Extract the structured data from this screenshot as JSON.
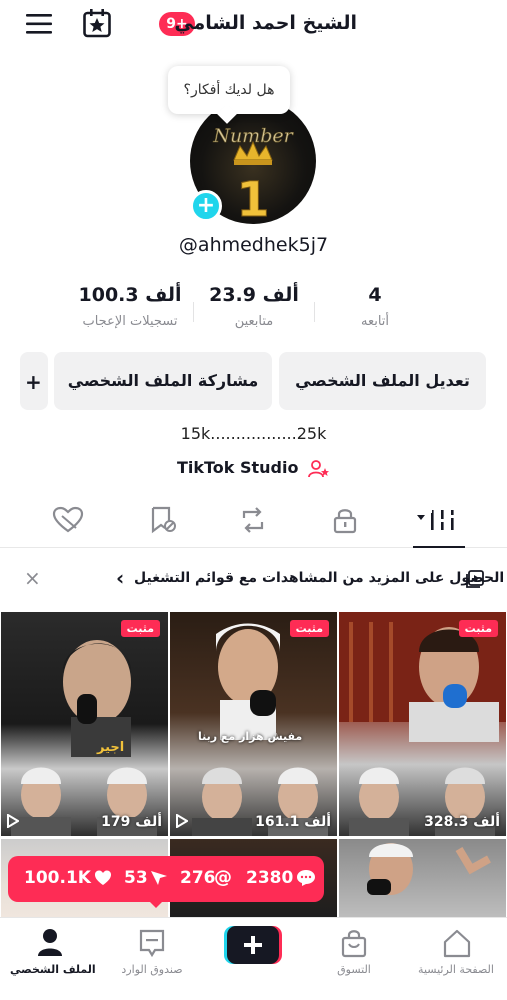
{
  "header": {
    "profile_name": "الشيخ احمد الشامي",
    "notif_badge": "9+",
    "icons": {
      "menu": "menu-icon",
      "calendar": "calendar-star-icon"
    }
  },
  "ideas_bubble": "هل لديك أفكار؟",
  "avatar_badge": "Number 1",
  "handle": "@ahmedhek5j7",
  "stats": [
    {
      "value": "100.3 ألف",
      "label": "تسجيلات الإعجاب"
    },
    {
      "value": "23.9 ألف",
      "label": "متابعين"
    },
    {
      "value": "4",
      "label": "أتابعه"
    }
  ],
  "buttons": {
    "edit_profile": "تعديل الملف الشخصي",
    "share_profile": "مشاركة الملف الشخصي",
    "add_friend": "+"
  },
  "follower_range": "15k.................25k",
  "studio": "TikTok Studio",
  "promo": {
    "text": "الحصول على المزيد من المشاهدات مع قوائم التشغيل",
    "chevron": "‹",
    "close": "×"
  },
  "videos": [
    {
      "pinned_label": "مثبت",
      "views": "179 ألف"
    },
    {
      "pinned_label": "مثبت",
      "views": "161.1 ألف"
    },
    {
      "pinned_label": "مثبت",
      "views": "328.3 ألف"
    }
  ],
  "video_captions": [
    "اجير",
    "مفيش هزار مع ربنا"
  ],
  "toast": {
    "likes": "100.1K",
    "shares": "53",
    "mentions": "276",
    "comments": "2380"
  },
  "bottom_nav": [
    {
      "label": "الملف الشخصي",
      "icon": "person-icon"
    },
    {
      "label": "صندوق الوارد",
      "icon": "inbox-icon"
    },
    {
      "label": "",
      "icon": "plus-create-icon"
    },
    {
      "label": "التسوق",
      "icon": "shopping-bag-icon"
    },
    {
      "label": "الصفحة الرئيسية",
      "icon": "home-icon"
    }
  ],
  "colors": {
    "accent": "#fe2c55",
    "cyan": "#20d5ec",
    "text": "#161823",
    "muted": "#8a8b91",
    "button_bg": "#f1f1f2"
  }
}
